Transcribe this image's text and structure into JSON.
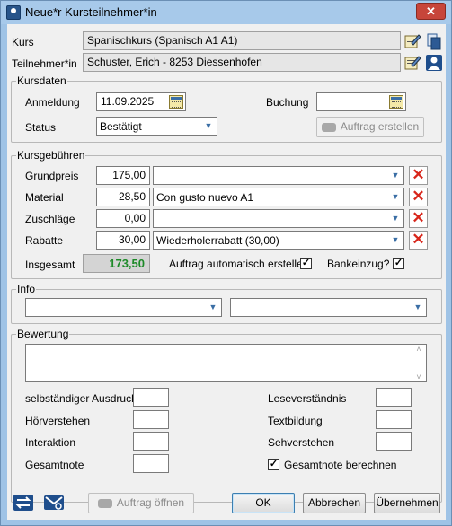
{
  "window": {
    "title": "Neue*r Kursteilnehmer*in",
    "close_glyph": "✕"
  },
  "header": {
    "kurs_label": "Kurs",
    "kurs_value": "Spanischkurs (Spanisch A1 A1)",
    "teilnehmer_label": "Teilnehmer*in",
    "teilnehmer_value": "Schuster, Erich - 8253 Diessenhofen"
  },
  "kursdaten": {
    "title": "Kursdaten",
    "anmeldung_label": "Anmeldung",
    "anmeldung_value": "11.09.2025",
    "buchung_label": "Buchung",
    "buchung_value": "",
    "status_label": "Status",
    "status_value": "Bestätigt",
    "auftrag_button": "Auftrag erstellen"
  },
  "gebuehren": {
    "title": "Kursgebühren",
    "rows": [
      {
        "label": "Grundpreis",
        "amount": "175,00",
        "combo": ""
      },
      {
        "label": "Material",
        "amount": "28,50",
        "combo": "Con gusto nuevo A1"
      },
      {
        "label": "Zuschläge",
        "amount": "0,00",
        "combo": ""
      },
      {
        "label": "Rabatte",
        "amount": "30,00",
        "combo": "Wiederholerrabatt (30,00)"
      }
    ],
    "delete_glyph": "✕",
    "insgesamt_label": "Insgesamt",
    "insgesamt_value": "173,50",
    "auto_auftrag_label": "Auftrag automatisch erstellen",
    "auto_auftrag_checked": true,
    "bankeinzug_label": "Bankeinzug?",
    "bankeinzug_checked": true,
    "total_color": "#1d8a28"
  },
  "info": {
    "title": "Info",
    "combo1": "",
    "combo2": ""
  },
  "bewertung": {
    "title": "Bewertung",
    "text": "",
    "left": [
      {
        "label": "selbständiger Ausdruck",
        "value": ""
      },
      {
        "label": "Hörverstehen",
        "value": ""
      },
      {
        "label": "Interaktion",
        "value": ""
      },
      {
        "label": "Gesamtnote",
        "value": ""
      }
    ],
    "right": [
      {
        "label": "Leseverständnis",
        "value": ""
      },
      {
        "label": "Textbildung",
        "value": ""
      },
      {
        "label": "Sehverstehen",
        "value": ""
      }
    ],
    "gesamtnote_berechnen_label": "Gesamtnote berechnen",
    "gesamtnote_berechnen_checked": true
  },
  "footer": {
    "auftrag_oeffnen": "Auftrag öffnen",
    "ok": "OK",
    "abbrechen": "Abbrechen",
    "uebernehmen": "Übernehmen"
  },
  "glyphs": {
    "dropdown": "▼",
    "check": "✓",
    "scroll_up": "˄",
    "scroll_down": "˅"
  }
}
